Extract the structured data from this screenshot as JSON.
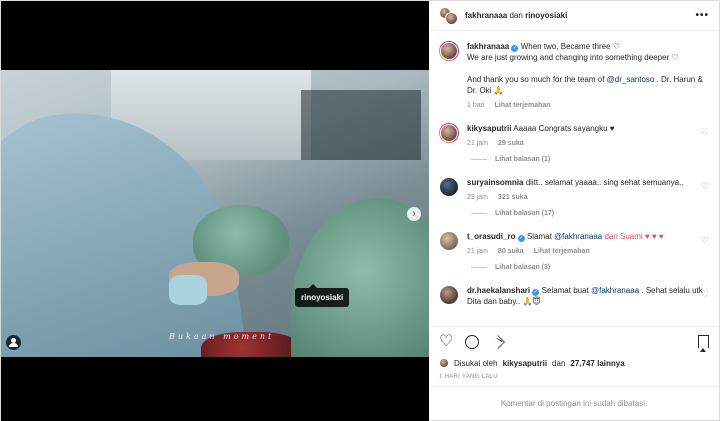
{
  "header": {
    "user1": "fakhranaaa",
    "conjunction": "dan",
    "user2": "rinoyosiaki",
    "more": "•••"
  },
  "media": {
    "watermark": "Bukaan moment",
    "tag_label": "rinoyosiaki",
    "carousel_total": 4,
    "carousel_active": 1
  },
  "caption": {
    "username": "fakhranaaa",
    "line1": "When two, Became three ♡",
    "line2": "We are just growing and changing into something deeper ♡",
    "line3a": "And thank you so much for the team of ",
    "mention": "@dr_santoso",
    "line3b": " . Dr. Harun & Dr. Oki 🙏",
    "time": "1 hari",
    "translate": "Lihat terjemahan"
  },
  "comments": [
    {
      "username": "kikysaputrii",
      "text": "Aaaaa Congrats sayangku ♥",
      "time": "21 jam",
      "likes": "29 suka",
      "translate": "",
      "replies": "Lihat balasan (1)"
    },
    {
      "username": "suryainsomnia",
      "text": "diitt.. selamat yaaaa.. sing sehat semuanya..",
      "time": "23 jam",
      "likes": "321 suka",
      "translate": "",
      "replies": "Lihat balasan (17)"
    },
    {
      "username": "t_orasudi_ro",
      "text_a": "Slamat ",
      "mention": "@fakhranaaa",
      "text_b": " dan Suami ♥ ♥ ♥",
      "time": "21 jam",
      "likes": "80 suka",
      "translate": "Lihat terjemahan",
      "replies": "Lihat balasan (3)"
    },
    {
      "username": "dr.haekalanshari",
      "text_a": "Selamat buat ",
      "mention": "@fakhranaaa",
      "text_b": " . Sehat selalu utk Dita dan baby.. 🙏😇"
    }
  ],
  "liked_by": {
    "prefix": "Disukai oleh",
    "user": "kikysaputrii",
    "middle": "dan",
    "count": "27.747 lainnya"
  },
  "date": "1 HARI YANG LALU",
  "comments_disabled": "Komentar di postingan ini sudah dibatasi."
}
